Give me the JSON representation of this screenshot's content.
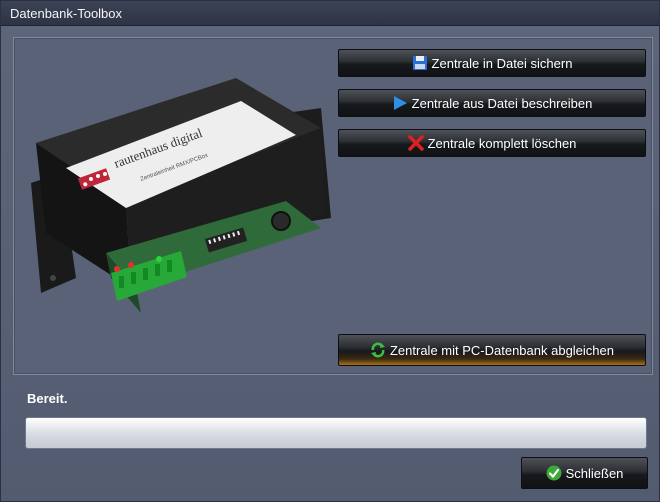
{
  "window": {
    "title": "Datenbank-Toolbox"
  },
  "buttons": {
    "save": "Zentrale in Datei sichern",
    "write": "Zentrale aus Datei beschreiben",
    "delete": "Zentrale komplett löschen",
    "sync": "Zentrale mit PC-Datenbank abgleichen",
    "close": "Schließen"
  },
  "device": {
    "brand": "rautenhaus digital",
    "model": "Zentraleinheit RMX/PCBox"
  },
  "status": {
    "text": "Bereit.",
    "progress": 0
  }
}
